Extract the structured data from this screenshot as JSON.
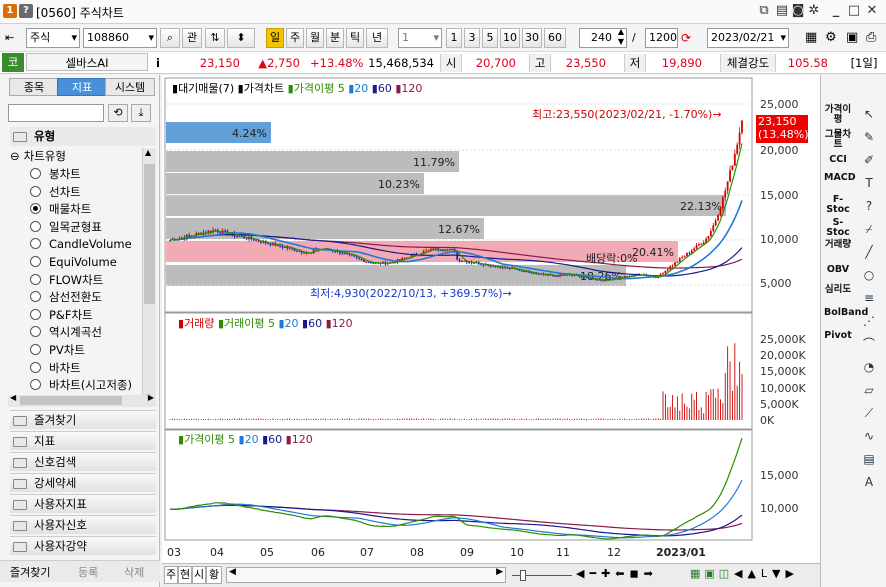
{
  "window": {
    "title": "[0560] 주식차트",
    "badge1": "1",
    "badge2": "?"
  },
  "toolbar": {
    "market_select": "주식",
    "code": "108860",
    "btn_search": "⌕",
    "btn_gwan": "관",
    "period_buttons": [
      "일",
      "주",
      "월",
      "분",
      "틱",
      "년"
    ],
    "period_selected": "일",
    "interval_select": "1",
    "num_buttons": [
      "1",
      "3",
      "5",
      "10",
      "30",
      "60"
    ],
    "count_value": "240",
    "count_total": "1200",
    "separator": "/",
    "date_value": "2023/02/21"
  },
  "quote": {
    "market_label": "코",
    "name": "셀바스AI",
    "info_icon": "i",
    "price": "23,150",
    "change": "▲2,750",
    "change_rate": "+13.48%",
    "volume": "15,468,534",
    "open_label": "시",
    "open": "20,700",
    "high_label": "고",
    "high": "23,550",
    "low_label": "저",
    "low": "19,890",
    "strength_label": "체결강도",
    "strength": "105.58",
    "period_badge": "[1일]"
  },
  "left_panel": {
    "tabs": [
      "종목",
      "지표",
      "시스템"
    ],
    "active_tab": "지표",
    "search_placeholder": "",
    "group_title": "유형",
    "tree_root": "차트유형",
    "items": [
      "봉차트",
      "선차트",
      "매물차트",
      "일목균형표",
      "CandleVolume",
      "EquiVolume",
      "FLOW차트",
      "삼선전환도",
      "P&F차트",
      "역시계곡선",
      "PV차트",
      "바차트",
      "바차트(시고저종)"
    ],
    "selected_item": "매물차트",
    "categories": [
      "즐겨찾기",
      "지표",
      "신호검색",
      "강세약세",
      "사용자지표",
      "사용자신호",
      "사용자강약"
    ],
    "bottom_tabs": [
      "즐겨찾기",
      "등록",
      "삭제"
    ]
  },
  "chart": {
    "legend_top": [
      "대기매물(7)",
      "가격차트",
      "가격이평 5",
      "20",
      "60",
      "120"
    ],
    "legend_volume": [
      "거래량",
      "거래이평 5",
      "20",
      "60",
      "120"
    ],
    "legend_ma": [
      "가격이평 5",
      "20",
      "60",
      "120"
    ],
    "annot_high": "최고:23,550(2023/02/21, -1.70%)→",
    "annot_low": "최저:4,930(2022/10/13, +369.57%)→",
    "annot_div": "배당락:0%",
    "price_tag": "23,150",
    "price_tag_pct": "(13.48%)",
    "price_axis": [
      "25,000",
      "20,000",
      "15,000",
      "10,000",
      "5,000"
    ],
    "volume_axis": [
      "25,000K",
      "20,000K",
      "15,000K",
      "10,000K",
      "5,000K",
      "0K"
    ],
    "ma_axis": [
      "15,000",
      "10,000"
    ],
    "x_axis": [
      "03",
      "04",
      "05",
      "06",
      "07",
      "08",
      "09",
      "10",
      "11",
      "12",
      "2023/01"
    ],
    "supply_bars": [
      "4.24%",
      "11.79%",
      "10.23%",
      "22.13%",
      "12.67%",
      "20.41%",
      "18.26%"
    ],
    "colors": {
      "ma5": "#2e8b00",
      "ma20": "#1e7bd8",
      "ma60": "#1a1a8c",
      "ma120": "#8b1a4a",
      "up": "#d20000",
      "down": "#0033cc",
      "supply": "#b8b8b8",
      "supply_hl": "#f2aab4",
      "supply_top": "#5b9bd5"
    }
  },
  "right_tools": {
    "labels": [
      "가격이평",
      "그물차트",
      "CCI",
      "MACD",
      "F-Stoc",
      "S-Stoc",
      "거래량",
      "OBV",
      "심리도",
      "BolBand",
      "Pivot"
    ],
    "icons": [
      "cursor-icon",
      "eraser-icon",
      "pencil-icon",
      "text-icon",
      "question-icon",
      "sweep-icon",
      "line-icon",
      "circle-icon",
      "fibo-icon",
      "gann-icon",
      "arc-icon",
      "cycle-icon",
      "channel-icon",
      "fan-icon",
      "wave-icon",
      "grid-icon",
      "auto-icon"
    ]
  },
  "bottom_bar": {
    "tabs": [
      "주",
      "현",
      "시",
      "황"
    ]
  }
}
